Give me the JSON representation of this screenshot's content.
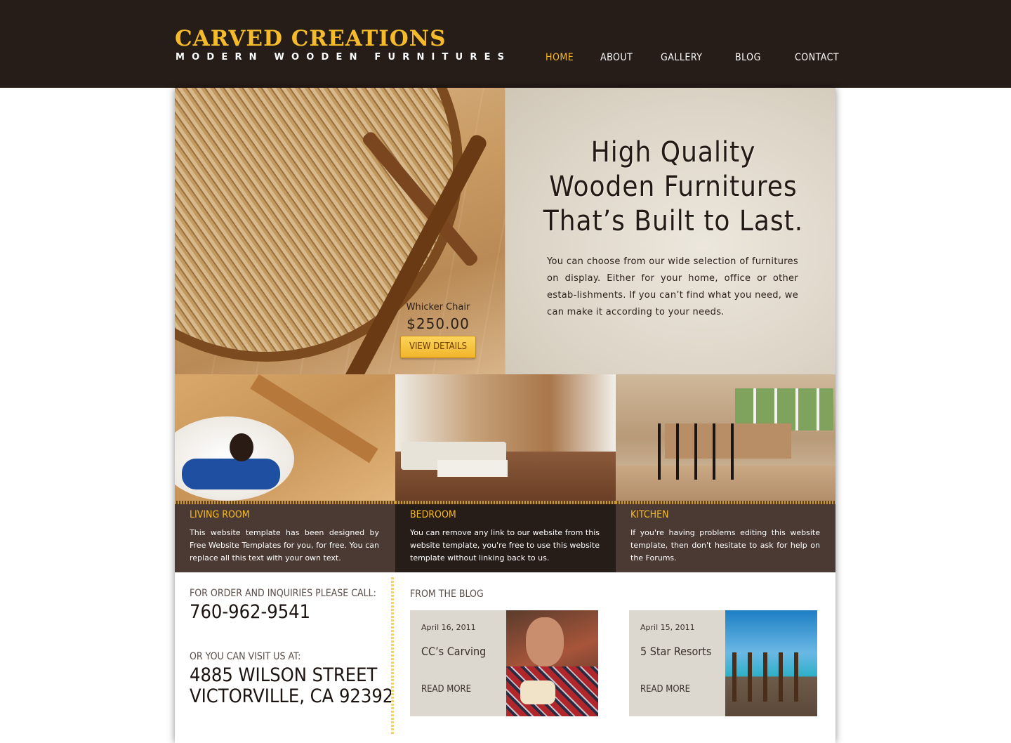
{
  "brand": {
    "title": "CARVED CREATIONS",
    "tagline": "MODERN WOODEN FURNITURES",
    "accent_color": "#f6bb2a",
    "header_color": "#261c18"
  },
  "nav": {
    "items": [
      {
        "label": "HOME",
        "active": true
      },
      {
        "label": "ABOUT",
        "active": false
      },
      {
        "label": "GALLERY",
        "active": false
      },
      {
        "label": "BLOG",
        "active": false
      },
      {
        "label": "CONTACT",
        "active": false
      }
    ]
  },
  "hero": {
    "product_name": "Whicker Chair",
    "product_price": "$250.00",
    "button_label": "VIEW DETAILS",
    "headline_lines": [
      "High Quality",
      "Wooden Furnitures",
      "That’s Built to Last."
    ],
    "description": "You can choose from our wide selection of furnitures on display. Either for your home, office or other estab-lishments. If you can’t find what you need, we can make it according to your needs."
  },
  "categories": [
    {
      "title": "LIVING ROOM",
      "text": "This website template has been designed by Free Website Templates for you, for free. You can replace all this text with your own text."
    },
    {
      "title": "BEDROOM",
      "text": "You can remove any link to our website from this website template, you're free to use this website template without linking back to us."
    },
    {
      "title": "KITCHEN",
      "text": "If you're having problems editing this website template, then don't hesitate to ask for help on the Forums."
    }
  ],
  "contact": {
    "phone_label": "FOR ORDER AND INQUIRIES PLEASE CALL:",
    "phone": "760-962-9541",
    "address_label": "OR YOU CAN VISIT US AT:",
    "address_line1": "4885 WILSON STREET",
    "address_line2": "VICTORVILLE, CA 92392"
  },
  "blog": {
    "heading": "FROM THE BLOG",
    "posts": [
      {
        "date": "April 16, 2011",
        "title": "CC’s Carving",
        "more": "READ MORE"
      },
      {
        "date": "April 15, 2011",
        "title": "5 Star Resorts",
        "more": "READ MORE"
      }
    ]
  }
}
